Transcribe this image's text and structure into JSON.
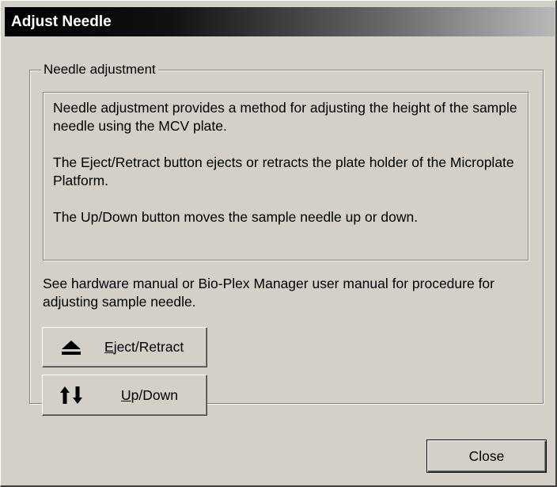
{
  "window": {
    "title": "Adjust Needle"
  },
  "group": {
    "legend": "Needle adjustment",
    "info_paragraphs": [
      "Needle adjustment provides a method for adjusting the height of the sample needle using the MCV plate.",
      "The Eject/Retract button ejects or retracts the plate holder of the Microplate Platform.",
      "The Up/Down button moves the sample needle up or down."
    ],
    "note": "See hardware manual or Bio-Plex Manager user manual for procedure for adjusting sample needle.",
    "eject_button": {
      "mnemonic": "E",
      "rest": "ject/Retract",
      "icon": "eject-icon"
    },
    "updown_button": {
      "mnemonic": "U",
      "rest": "p/Down",
      "icon": "up-down-arrows-icon"
    }
  },
  "footer": {
    "close_label": "Close"
  }
}
